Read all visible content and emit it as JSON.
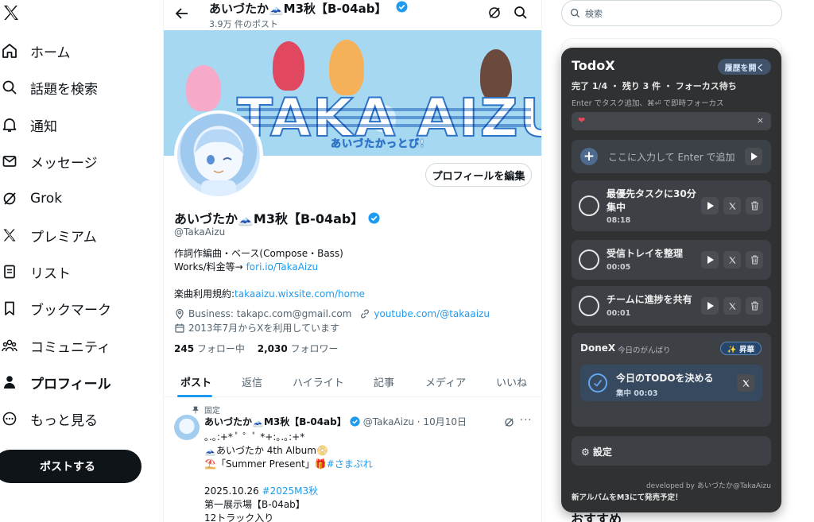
{
  "nav": {
    "items": [
      {
        "label": "ホーム",
        "icon": "home-icon"
      },
      {
        "label": "話題を検索",
        "icon": "search-icon"
      },
      {
        "label": "通知",
        "icon": "bell-icon"
      },
      {
        "label": "メッセージ",
        "icon": "mail-icon"
      },
      {
        "label": "Grok",
        "icon": "grok-icon"
      },
      {
        "label": "プレミアム",
        "icon": "x-logo-icon"
      },
      {
        "label": "リスト",
        "icon": "list-icon"
      },
      {
        "label": "ブックマーク",
        "icon": "bookmark-icon"
      },
      {
        "label": "コミュニティ",
        "icon": "communities-icon"
      },
      {
        "label": "プロフィール",
        "icon": "person-icon"
      },
      {
        "label": "もっと見る",
        "icon": "more-circle-icon"
      }
    ],
    "post_label": "ポストする"
  },
  "header": {
    "name": "あいづたか🗻M3秋【B-04ab】",
    "post_count": "3.9万 件のポスト"
  },
  "banner": {
    "word": "TAKA AIZU",
    "subtitle": "あいづたかっとび!"
  },
  "profile": {
    "edit_label": "プロフィールを編集",
    "display_name": "あいづたか🗻M3秋【B-04ab】",
    "handle": "@TakaAizu",
    "bio_line1": "作詞作編曲・ベース(Compose・Bass)",
    "bio_line2_prefix": "Works/料金等→ ",
    "bio_line2_link": "fori.io/TakaAizu",
    "bio_line3_prefix": "楽曲利用規約:",
    "bio_line3_link": "takaaizu.wixsite.com/home",
    "business": "Business: takapc.com@gmail.com",
    "website": "youtube.com/@takaaizu",
    "joined": "2013年7月からXを利用しています",
    "following_count": "245",
    "following_label": " フォロー中",
    "followers_count": "2,030",
    "followers_label": " フォロワー"
  },
  "tabs": [
    "ポスト",
    "返信",
    "ハイライト",
    "記事",
    "メディア",
    "いいね"
  ],
  "tweet": {
    "pinned_label": "固定",
    "name": "あいづたか🗻M3秋【B-04ab】",
    "handle_date": "@TakaAizu · 10月10日",
    "line1": "｡.｡:+* ﾟ ゜ﾟ *+:｡.｡:+*",
    "line2": "🗻あいづたか 4th Album📀",
    "line3_prefix": "⛱️「Summer Present」🎁",
    "line3_tag": "#さまぷれ",
    "line4_prefix": "2025.10.26 ",
    "line4_tag": "#2025M3秋",
    "line5": "第一展示場【B-04ab】",
    "line6": "12トラック入り"
  },
  "search": {
    "placeholder": "検索"
  },
  "recommend_title": "おすすめ",
  "todox": {
    "title": "TodoX",
    "history_label": "履歴を開く",
    "status": "完了 1/4 ・ 残り 3 件 ・ フォーカス待ち",
    "hint": "Enter でタスク追加、⌘⏎ で即時フォーカス",
    "focus_clear": "×",
    "input_placeholder": "ここに入力して Enter で追加",
    "tasks": [
      {
        "name_line1": "最優先タスクに30分",
        "name_line2": "集中",
        "time": "08:18"
      },
      {
        "name_line1": "受信トレイを整理",
        "time": "00:05"
      },
      {
        "name_line1": "チームに進捗を共有",
        "time": "00:01"
      }
    ],
    "donex": {
      "title": "DoneX",
      "subtitle": "今日のがんばり",
      "boost_label": "✨ 昇華",
      "item_name": "今日のTODOを決める",
      "item_meta": "集中 00:03"
    },
    "settings_label": "⚙ 設定",
    "developed_by": "developed by あいづたか@TakaAizu",
    "news": "新アルバムをM3にて発売予定！"
  },
  "colors": {
    "accent": "#1d9bf0",
    "text": "#0f1419",
    "muted": "#536471",
    "panel": "#2f3133",
    "banner": "#a6d8f2"
  }
}
